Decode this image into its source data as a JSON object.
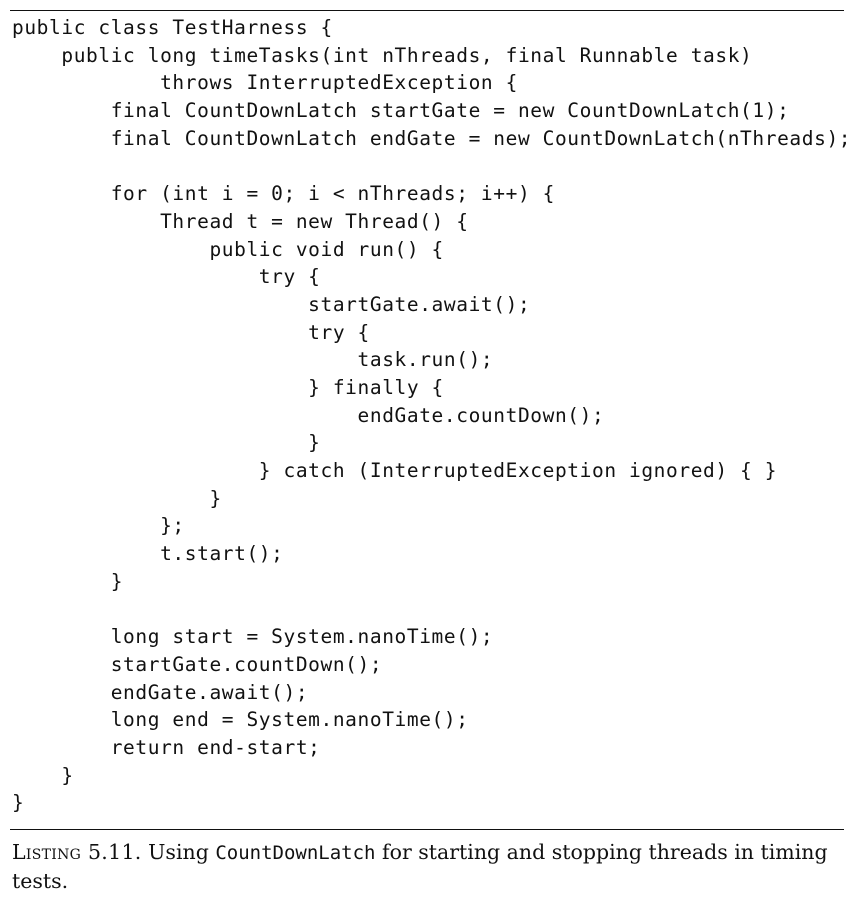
{
  "listing": {
    "code_lines": [
      "public class TestHarness {",
      "    public long timeTasks(int nThreads, final Runnable task)",
      "            throws InterruptedException {",
      "        final CountDownLatch startGate = new CountDownLatch(1);",
      "        final CountDownLatch endGate = new CountDownLatch(nThreads);",
      "",
      "        for (int i = 0; i < nThreads; i++) {",
      "            Thread t = new Thread() {",
      "                public void run() {",
      "                    try {",
      "                        startGate.await();",
      "                        try {",
      "                            task.run();",
      "                        } finally {",
      "                            endGate.countDown();",
      "                        }",
      "                    } catch (InterruptedException ignored) { }",
      "                }",
      "            };",
      "            t.start();",
      "        }",
      "",
      "        long start = System.nanoTime();",
      "        startGate.countDown();",
      "        endGate.await();",
      "        long end = System.nanoTime();",
      "        return end-start;",
      "    }",
      "}"
    ],
    "caption": {
      "label": "Listing 5.11.",
      "text_before": " Using ",
      "code_term": "CountDownLatch",
      "text_after": " for starting and stopping threads in timing tests."
    }
  }
}
